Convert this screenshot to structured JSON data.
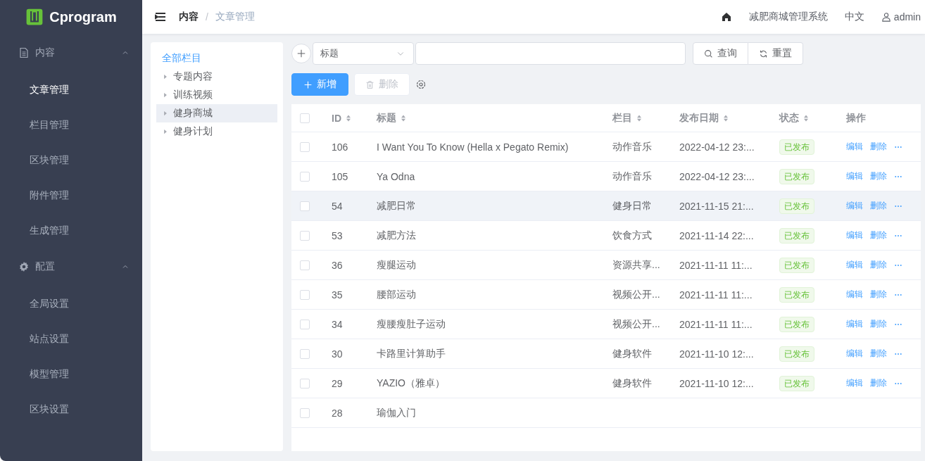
{
  "sidebar": {
    "logo": "Cprogram",
    "groups": [
      {
        "label": "内容",
        "expanded": true,
        "items": [
          {
            "label": "文章管理",
            "selected": true
          },
          {
            "label": "栏目管理",
            "selected": false
          },
          {
            "label": "区块管理",
            "selected": false
          },
          {
            "label": "附件管理",
            "selected": false
          },
          {
            "label": "生成管理",
            "selected": false
          }
        ]
      },
      {
        "label": "配置",
        "expanded": true,
        "items": [
          {
            "label": "全局设置",
            "selected": false
          },
          {
            "label": "站点设置",
            "selected": false
          },
          {
            "label": "模型管理",
            "selected": false
          },
          {
            "label": "区块设置",
            "selected": false
          }
        ]
      }
    ]
  },
  "header": {
    "breadcrumb": [
      "内容",
      "文章管理"
    ],
    "separator": "/",
    "site_name": "减肥商城管理系统",
    "language": "中文",
    "user": "admin"
  },
  "tree": {
    "root": {
      "label": "全部栏目",
      "selected": true
    },
    "items": [
      {
        "label": "专题内容",
        "highlighted": false
      },
      {
        "label": "训练视频",
        "highlighted": false
      },
      {
        "label": "健身商城",
        "highlighted": true
      },
      {
        "label": "健身计划",
        "highlighted": false
      }
    ]
  },
  "filter": {
    "field": "标题",
    "query_button": "查询",
    "reset_button": "重置"
  },
  "actions": {
    "add_button": "新增",
    "delete_button": {
      "label": "删除",
      "disabled": true
    }
  },
  "table": {
    "all_checked": false,
    "columns": [
      {
        "label": "ID",
        "sortable": true
      },
      {
        "label": "标题",
        "sortable": true
      },
      {
        "label": "栏目",
        "sortable": true
      },
      {
        "label": "发布日期",
        "sortable": true
      },
      {
        "label": "状态",
        "sortable": true
      },
      {
        "label": "操作",
        "sortable": false
      }
    ],
    "rows": [
      {
        "checked": false,
        "highlighted": false,
        "id": "106",
        "title": "I Want You To Know (Hella x Pegato Remix)",
        "category": "动作音乐",
        "date": "2022-04-12 23:...",
        "status": "已发布",
        "actions": [
          "编辑",
          "删除"
        ]
      },
      {
        "checked": false,
        "highlighted": false,
        "id": "105",
        "title": "Ya Odna",
        "category": "动作音乐",
        "date": "2022-04-12 23:...",
        "status": "已发布",
        "actions": [
          "编辑",
          "删除"
        ]
      },
      {
        "checked": false,
        "highlighted": true,
        "id": "54",
        "title": "减肥日常",
        "category": "健身日常",
        "date": "2021-11-15 21:...",
        "status": "已发布",
        "actions": [
          "编辑",
          "删除"
        ]
      },
      {
        "checked": false,
        "highlighted": false,
        "id": "53",
        "title": "减肥方法",
        "category": "饮食方式",
        "date": "2021-11-14 22:...",
        "status": "已发布",
        "actions": [
          "编辑",
          "删除"
        ]
      },
      {
        "checked": false,
        "highlighted": false,
        "id": "36",
        "title": "瘦腿运动",
        "category": "资源共享...",
        "date": "2021-11-11 11:...",
        "status": "已发布",
        "actions": [
          "编辑",
          "删除"
        ]
      },
      {
        "checked": false,
        "highlighted": false,
        "id": "35",
        "title": "腰部运动",
        "category": "视频公开...",
        "date": "2021-11-11 11:...",
        "status": "已发布",
        "actions": [
          "编辑",
          "删除"
        ]
      },
      {
        "checked": false,
        "highlighted": false,
        "id": "34",
        "title": "瘦腰瘦肚子运动",
        "category": "视频公开...",
        "date": "2021-11-11 11:...",
        "status": "已发布",
        "actions": [
          "编辑",
          "删除"
        ]
      },
      {
        "checked": false,
        "highlighted": false,
        "id": "30",
        "title": "卡路里计算助手",
        "category": "健身软件",
        "date": "2021-11-10 12:...",
        "status": "已发布",
        "actions": [
          "编辑",
          "删除"
        ]
      },
      {
        "checked": false,
        "highlighted": false,
        "id": "29",
        "title": "YAZIO（雅卓）",
        "category": "健身软件",
        "date": "2021-11-10 12:...",
        "status": "已发布",
        "actions": [
          "编辑",
          "删除"
        ]
      },
      {
        "checked": false,
        "highlighted": false,
        "id": "28",
        "title": "瑜伽入门"
      }
    ]
  }
}
